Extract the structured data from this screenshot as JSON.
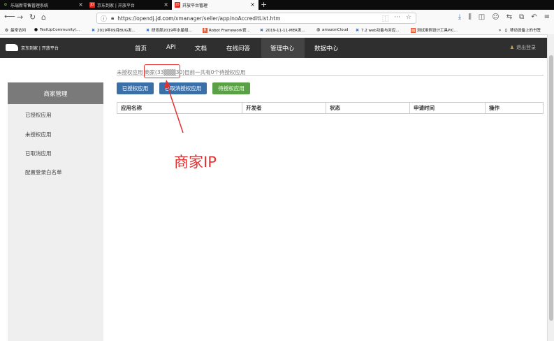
{
  "browser": {
    "tabs": [
      {
        "label": "乐瑞新零售管理系统",
        "active": false
      },
      {
        "label": "京东到家 | 开放平台",
        "active": false
      },
      {
        "label": "开放平台管理",
        "active": true
      }
    ],
    "url_prefix": "https://opendj.",
    "url_domain": "jd.com",
    "url_path": "/xmanager/seller/app/noAccreditList.htm",
    "bookmarks": [
      "最常访问",
      "TestUpCommunity/...",
      "2019年09月BUG发...",
      "研发部2019年水星组...",
      "Robot Framework官...",
      "2019-11-11-MER发...",
      "amazonCloud",
      "7.2 web功能与对应...",
      "测试用例设计工具PIC...",
      "移动设备上的书签"
    ]
  },
  "app": {
    "logo_text": "京东到家 | 开放平台",
    "nav": [
      "首页",
      "API",
      "文档",
      "在线问答",
      "管理中心",
      "数据中心"
    ],
    "nav_active": "管理中心",
    "logout": "退出登录"
  },
  "sidebar": {
    "title": "商家管理",
    "items": [
      "已授权应用",
      "未授权应用",
      "已取消应用",
      "配置登录白名单"
    ]
  },
  "content": {
    "breadcrumb_prefix": "未授权应用",
    "breadcrumb_ip": "商家(33▒▒▒30)",
    "breadcrumb_suffix": "目前一共有0个待授权应用",
    "buttons": [
      "已授权应用",
      "已取消授权应用",
      "待授权应用"
    ],
    "button_colors": [
      "#3a6fa8",
      "#3a6fa8",
      "#5aa045"
    ],
    "columns": [
      "应用名称",
      "开发者",
      "状态",
      "申请时间",
      "操作"
    ]
  },
  "annotation": {
    "label": "商家IP",
    "color": "#e53030"
  }
}
